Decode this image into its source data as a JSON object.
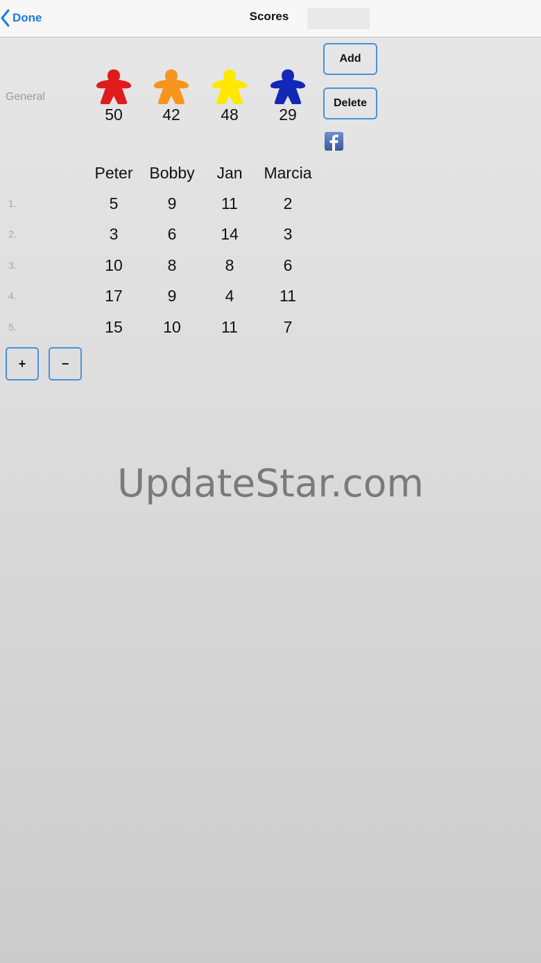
{
  "nav": {
    "back_label": "Done",
    "title": "Scores"
  },
  "general_label": "General",
  "players": [
    {
      "name": "Peter",
      "color": "#e01b1b",
      "total": "50",
      "scores": [
        "5",
        "3",
        "10",
        "17",
        "15"
      ]
    },
    {
      "name": "Bobby",
      "color": "#f7941d",
      "total": "42",
      "scores": [
        "9",
        "6",
        "8",
        "9",
        "10"
      ]
    },
    {
      "name": "Jan",
      "color": "#ffe800",
      "total": "48",
      "scores": [
        "11",
        "14",
        "8",
        "4",
        "11"
      ]
    },
    {
      "name": "Marcia",
      "color": "#1428b8",
      "total": "29",
      "scores": [
        "2",
        "3",
        "6",
        "11",
        "7"
      ]
    }
  ],
  "rounds": [
    "1.",
    "2.",
    "3.",
    "4.",
    "5."
  ],
  "buttons": {
    "add": "Add",
    "delete": "Delete",
    "plus": "+",
    "minus": "−"
  },
  "icons": {
    "back": "chevron-left-icon",
    "facebook": "facebook-icon",
    "meeple": "meeple-icon"
  },
  "colors": {
    "accent": "#1a7ae0",
    "button_border": "#4a90d9",
    "facebook": "#3b5998"
  },
  "watermark": "UpdateStar.com"
}
